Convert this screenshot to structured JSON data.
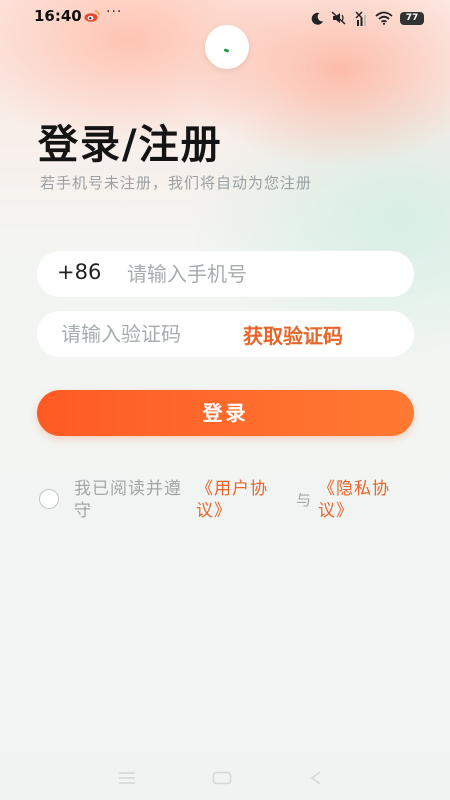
{
  "status_bar": {
    "time": "16:40",
    "more": "···",
    "battery": "77",
    "icons": [
      "weibo-icon",
      "moon-icon",
      "mute-icon",
      "no-sim-icon",
      "wifi-icon",
      "battery-icon"
    ]
  },
  "login": {
    "title": "登录/注册",
    "subtitle": "若手机号未注册，我们将自动为您注册",
    "country_code": "+86",
    "phone_placeholder": "请输入手机号",
    "code_placeholder": "请输入验证码",
    "get_code_label": "获取验证码",
    "login_button_label": "登录"
  },
  "agreement": {
    "prefix": "我已阅读并遵守",
    "user_agreement": "《用户协议》",
    "and": "与",
    "privacy_policy": "《隐私协议》"
  },
  "nav_bar": {
    "icons": [
      "menu-icon",
      "home-icon",
      "back-icon"
    ]
  },
  "colors": {
    "accent": "#e8652a",
    "button_start": "#ff5a24",
    "button_end": "#ff7a32"
  }
}
